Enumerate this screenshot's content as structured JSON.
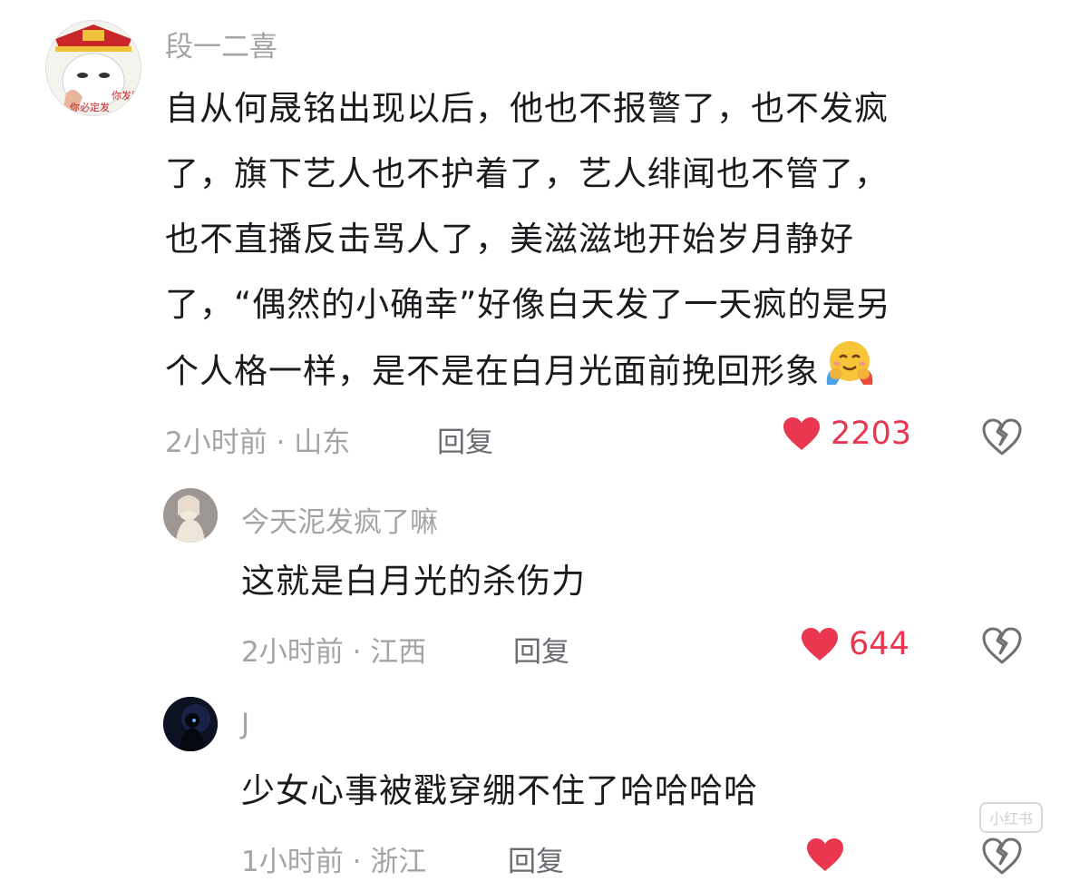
{
  "comments": [
    {
      "username": "段一二喜",
      "text": "自从何晟铭出现以后，他也不报警了，也不发疯了，旗下艺人也不护着了，艺人绯闻也不管了，也不直播反击骂人了，美滋滋地开始岁月静好了，“偶然的小确幸”好像白天发了一天疯的是另个人格一样，是不是在白月光面前挽回形象",
      "lines": [
        "自从何晟铭出现以后，他也不报警了，也不发疯",
        "了，旗下艺人也不护着了，艺人绯闻也不管了，",
        "也不直播反击骂人了，美滋滋地开始岁月静好",
        "了，“偶然的小确幸”好像白天发了一天疯的是另",
        "个人格一样，是不是在白月光面前挽回形象"
      ],
      "emoji": "hugging-face-emoji",
      "avatar_text": [
        "你发财",
        "你必定发"
      ],
      "meta": "2小时前 · 山东",
      "reply_label": "回复",
      "likes": "2203"
    },
    {
      "username": "今天泥发疯了嘛",
      "text": "这就是白月光的杀伤力",
      "meta": "2小时前 · 江西",
      "reply_label": "回复",
      "likes": "644"
    },
    {
      "username": "J",
      "text": "少女心事被戳穿绷不住了哈哈哈哈",
      "meta": "1小时前 · 浙江",
      "reply_label": "回复",
      "likes": ""
    }
  ],
  "watermark": "小红书",
  "colors": {
    "like": "#e8374f",
    "secondary_text": "#a3a3a8",
    "primary_text": "#1b1b1f"
  }
}
